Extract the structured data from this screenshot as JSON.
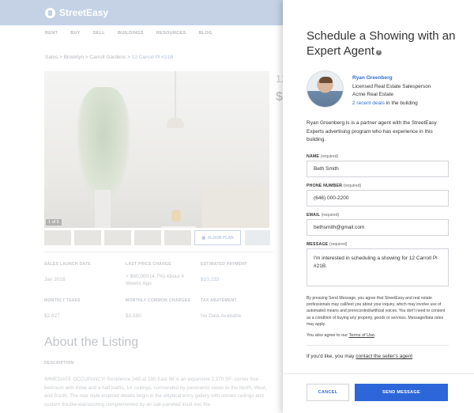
{
  "background": {
    "brand": "StreetEasy",
    "nav": [
      "RENT",
      "BUY",
      "SELL",
      "BUILDINGS",
      "RESOURCES",
      "BLOG"
    ],
    "breadcrumb": {
      "sales": "Sales",
      "brooklyn": "Brooklyn",
      "neighborhood": "Carroll Gardens",
      "unit": "12 Carroll Pl #21B",
      "separator": ">"
    },
    "photo_counter": "1 of 6",
    "floor_plan_label": "FLOOR PLAN",
    "price_peek_top": "12",
    "price_peek_bottom": "$",
    "facts": [
      {
        "label": "SALES LAUNCH DATE",
        "value": "Jan 2016"
      },
      {
        "label": "LAST PRICE CHANGE",
        "value": "+ $60,000 (4.7%) About 4 Weeks Ago"
      },
      {
        "label": "ESTIMATED PAYMENT",
        "value": "$10,233"
      },
      {
        "label": "MONTHLY TAXES",
        "value": "$2,827"
      },
      {
        "label": "MONTHLY COMMON CHARGES",
        "value": "$3,590"
      },
      {
        "label": "TAX ABATEMENT",
        "value": "No Data Available"
      }
    ],
    "about_title": "About the Listing",
    "description_label": "DESCRIPTION",
    "description_text": "IMMEDIATE OCCUPANCY! Residence 24B at 180 East 88 is an expansive 2,370 SF- corner four-bedroom with three and a half baths, 14' ceilings, surrounded by panoramic views to the North, West, and South. The rear style-inspired details begin in the elliptical entry gallery with stoned ceilings and custom double-wainscoting complemented by an oak-paneled inset into the"
  },
  "modal": {
    "title": "Schedule a Showing with an Expert Agent",
    "agent": {
      "name": "Ryan Greenberg",
      "role": "Licensed Real Estate Salesperson",
      "company": "Acme Real Estate",
      "deals_link": "2 recent deals",
      "deals_suffix": " in the building"
    },
    "agent_description": "Ryan Greenberg is is a partner agent with the StreetEasy Experts advertising program who has experience in this building.",
    "required_label": "(required)",
    "fields": {
      "name": {
        "label": "NAME",
        "value": "Beth Smith"
      },
      "phone": {
        "label": "PHONE NUMBER",
        "value": "(646) 000-2200"
      },
      "email": {
        "label": "EMAIL",
        "value": "bethsmith@gmail.com"
      },
      "message": {
        "label": "MESSAGE",
        "value": "I'm interested in scheduling a showing for 12 Carroll Pl #21B."
      }
    },
    "disclaimer": "By pressing Send Message, you agree that StreetEasy and real estate professionals may call/text you about your inquiry, which may involve use of automated means and prerecorded/artificial voices. You don't need to consent as a condition of buying any property, goods or services. Message/data rates may apply.",
    "agree_prefix": "You also agree to our ",
    "terms_link": "Terms of Use",
    "agree_suffix": ".",
    "contact_prefix": "If you'd like, you may ",
    "contact_link": "contact the seller's agent",
    "cancel_label": "CANCEL",
    "send_label": "SEND MESSAGE"
  },
  "colors": {
    "accent": "#2d66d9",
    "link": "#2f6fd1",
    "topbar": "#c5d2e6"
  }
}
